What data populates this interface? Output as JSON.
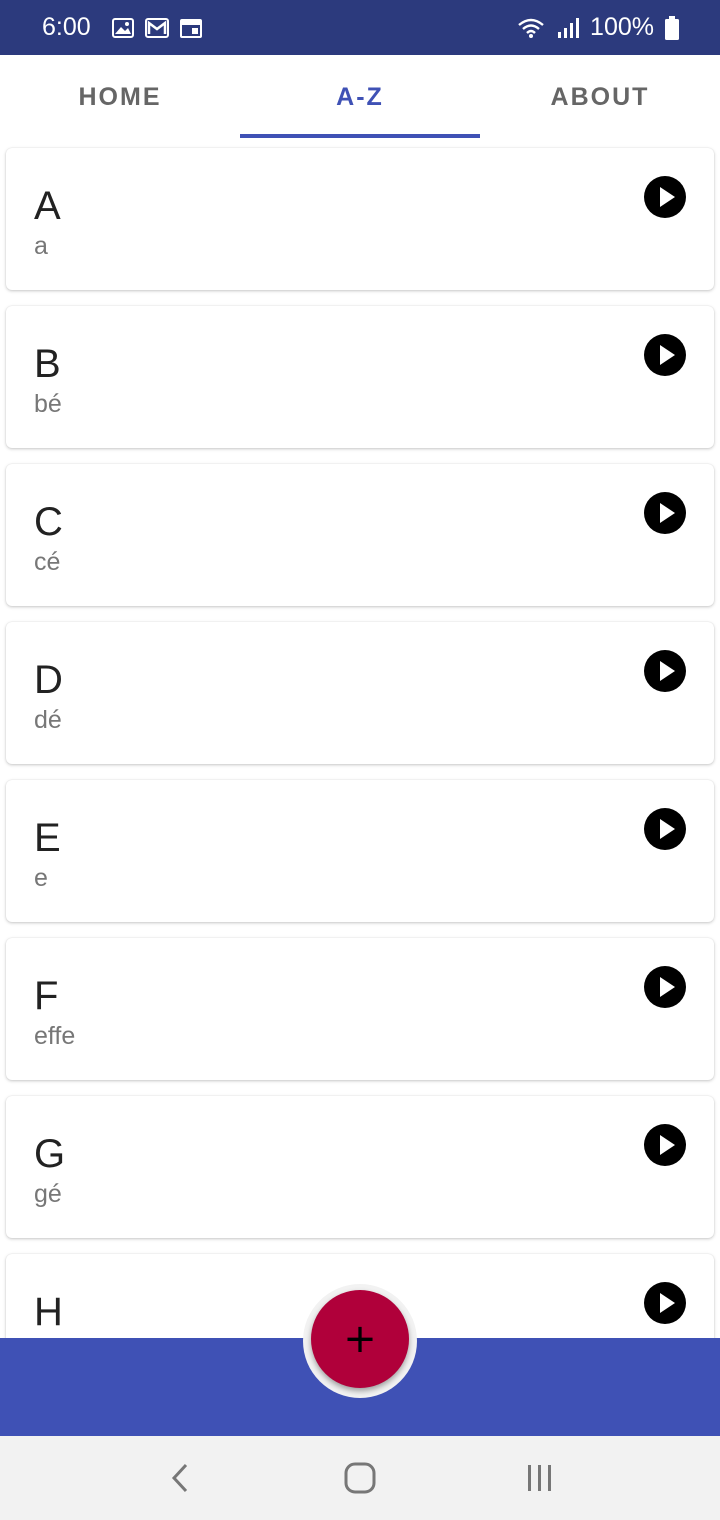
{
  "status_bar": {
    "time": "6:00",
    "battery": "100%",
    "icons": [
      "image-icon",
      "gmail-icon",
      "calendar-icon",
      "wifi-icon",
      "signal-icon",
      "battery-icon"
    ]
  },
  "tabs": [
    {
      "label": "HOME",
      "active": false
    },
    {
      "label": "A-Z",
      "active": true
    },
    {
      "label": "ABOUT",
      "active": false
    }
  ],
  "letters": [
    {
      "letter": "A",
      "pronunciation": "a"
    },
    {
      "letter": "B",
      "pronunciation": "bé"
    },
    {
      "letter": "C",
      "pronunciation": "cé"
    },
    {
      "letter": "D",
      "pronunciation": "dé"
    },
    {
      "letter": "E",
      "pronunciation": "e"
    },
    {
      "letter": "F",
      "pronunciation": "effe"
    },
    {
      "letter": "G",
      "pronunciation": "gé"
    },
    {
      "letter": "H",
      "pronunciation": ""
    }
  ],
  "fab": {
    "label": "+"
  },
  "colors": {
    "status_bar": "#2c3a7d",
    "primary": "#3f51b5",
    "fab": "#b0003a"
  }
}
